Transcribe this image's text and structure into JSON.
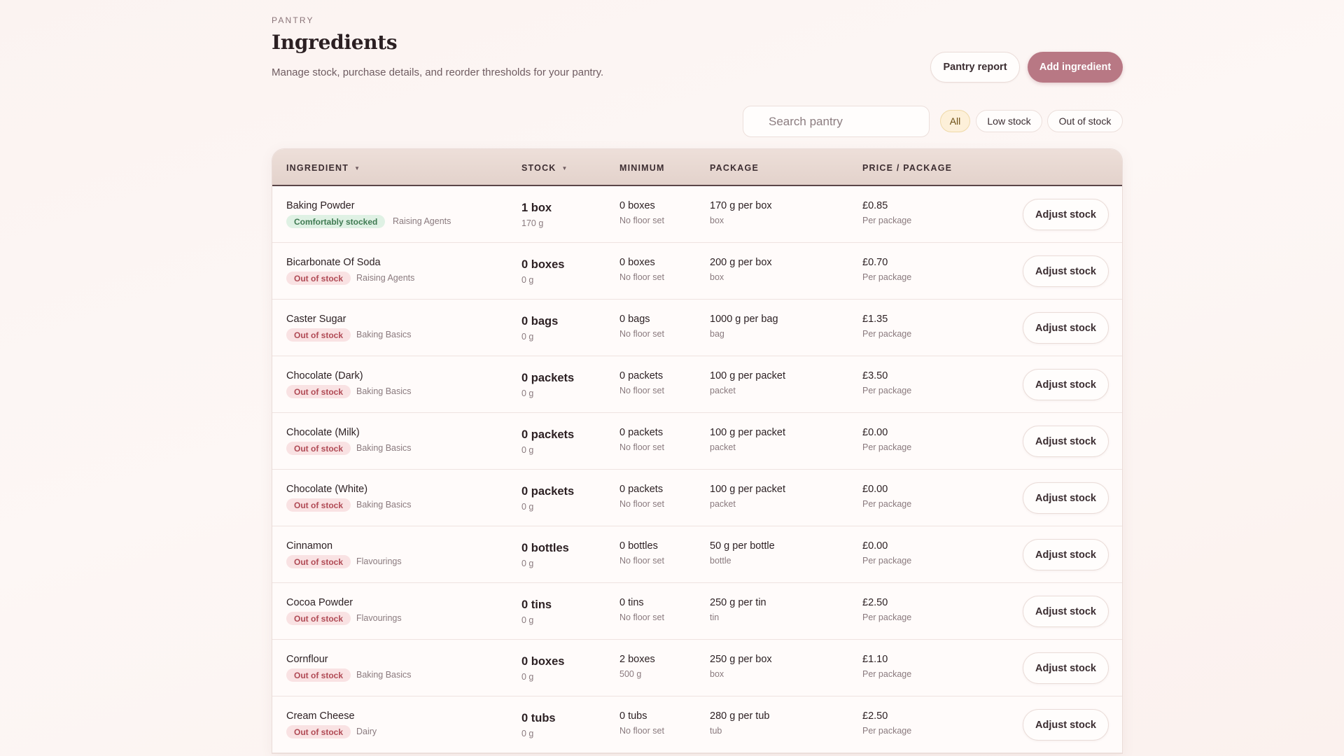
{
  "header": {
    "eyebrow": "PANTRY",
    "title": "Ingredients",
    "subtitle": "Manage stock, purchase details, and reorder thresholds for your pantry.",
    "report_label": "Pantry report",
    "add_label": "Add ingredient"
  },
  "search": {
    "placeholder": "Search pantry"
  },
  "filters": {
    "all": "All",
    "low": "Low stock",
    "out": "Out of stock",
    "active": "All"
  },
  "columns": {
    "ingredient": "INGREDIENT",
    "stock": "STOCK",
    "minimum": "MINIMUM",
    "package": "PACKAGE",
    "price": "PRICE / PACKAGE"
  },
  "colors": {
    "accent": "#b87884",
    "ok_badge": "#dff1e4",
    "out_badge": "#f9e2e3",
    "active_chip": "#fdf0d9"
  },
  "rows": [
    {
      "name": "Baking Powder",
      "status": "Comfortably stocked",
      "status_type": "ok",
      "category": "Raising Agents",
      "stock": "1 box",
      "stock_grams": "170 g",
      "minimum": "0 boxes",
      "minimum_sub": "No floor set",
      "package": "170 g per box",
      "package_unit": "box",
      "price": "£0.85",
      "price_sub": "Per package",
      "action": "Adjust stock"
    },
    {
      "name": "Bicarbonate Of Soda",
      "status": "Out of stock",
      "status_type": "out",
      "category": "Raising Agents",
      "stock": "0 boxes",
      "stock_grams": "0 g",
      "minimum": "0 boxes",
      "minimum_sub": "No floor set",
      "package": "200 g per box",
      "package_unit": "box",
      "price": "£0.70",
      "price_sub": "Per package",
      "action": "Adjust stock"
    },
    {
      "name": "Caster Sugar",
      "status": "Out of stock",
      "status_type": "out",
      "category": "Baking Basics",
      "stock": "0 bags",
      "stock_grams": "0 g",
      "minimum": "0 bags",
      "minimum_sub": "No floor set",
      "package": "1000 g per bag",
      "package_unit": "bag",
      "price": "£1.35",
      "price_sub": "Per package",
      "action": "Adjust stock"
    },
    {
      "name": "Chocolate (Dark)",
      "status": "Out of stock",
      "status_type": "out",
      "category": "Baking Basics",
      "stock": "0 packets",
      "stock_grams": "0 g",
      "minimum": "0 packets",
      "minimum_sub": "No floor set",
      "package": "100 g per packet",
      "package_unit": "packet",
      "price": "£3.50",
      "price_sub": "Per package",
      "action": "Adjust stock"
    },
    {
      "name": "Chocolate (Milk)",
      "status": "Out of stock",
      "status_type": "out",
      "category": "Baking Basics",
      "stock": "0 packets",
      "stock_grams": "0 g",
      "minimum": "0 packets",
      "minimum_sub": "No floor set",
      "package": "100 g per packet",
      "package_unit": "packet",
      "price": "£0.00",
      "price_sub": "Per package",
      "action": "Adjust stock"
    },
    {
      "name": "Chocolate (White)",
      "status": "Out of stock",
      "status_type": "out",
      "category": "Baking Basics",
      "stock": "0 packets",
      "stock_grams": "0 g",
      "minimum": "0 packets",
      "minimum_sub": "No floor set",
      "package": "100 g per packet",
      "package_unit": "packet",
      "price": "£0.00",
      "price_sub": "Per package",
      "action": "Adjust stock"
    },
    {
      "name": "Cinnamon",
      "status": "Out of stock",
      "status_type": "out",
      "category": "Flavourings",
      "stock": "0 bottles",
      "stock_grams": "0 g",
      "minimum": "0 bottles",
      "minimum_sub": "No floor set",
      "package": "50 g per bottle",
      "package_unit": "bottle",
      "price": "£0.00",
      "price_sub": "Per package",
      "action": "Adjust stock"
    },
    {
      "name": "Cocoa Powder",
      "status": "Out of stock",
      "status_type": "out",
      "category": "Flavourings",
      "stock": "0 tins",
      "stock_grams": "0 g",
      "minimum": "0 tins",
      "minimum_sub": "No floor set",
      "package": "250 g per tin",
      "package_unit": "tin",
      "price": "£2.50",
      "price_sub": "Per package",
      "action": "Adjust stock"
    },
    {
      "name": "Cornflour",
      "status": "Out of stock",
      "status_type": "out",
      "category": "Baking Basics",
      "stock": "0 boxes",
      "stock_grams": "0 g",
      "minimum": "2 boxes",
      "minimum_sub": "500 g",
      "package": "250 g per box",
      "package_unit": "box",
      "price": "£1.10",
      "price_sub": "Per package",
      "action": "Adjust stock"
    },
    {
      "name": "Cream Cheese",
      "status": "Out of stock",
      "status_type": "out",
      "category": "Dairy",
      "stock": "0 tubs",
      "stock_grams": "0 g",
      "minimum": "0 tubs",
      "minimum_sub": "No floor set",
      "package": "280 g per tub",
      "package_unit": "tub",
      "price": "£2.50",
      "price_sub": "Per package",
      "action": "Adjust stock"
    }
  ]
}
